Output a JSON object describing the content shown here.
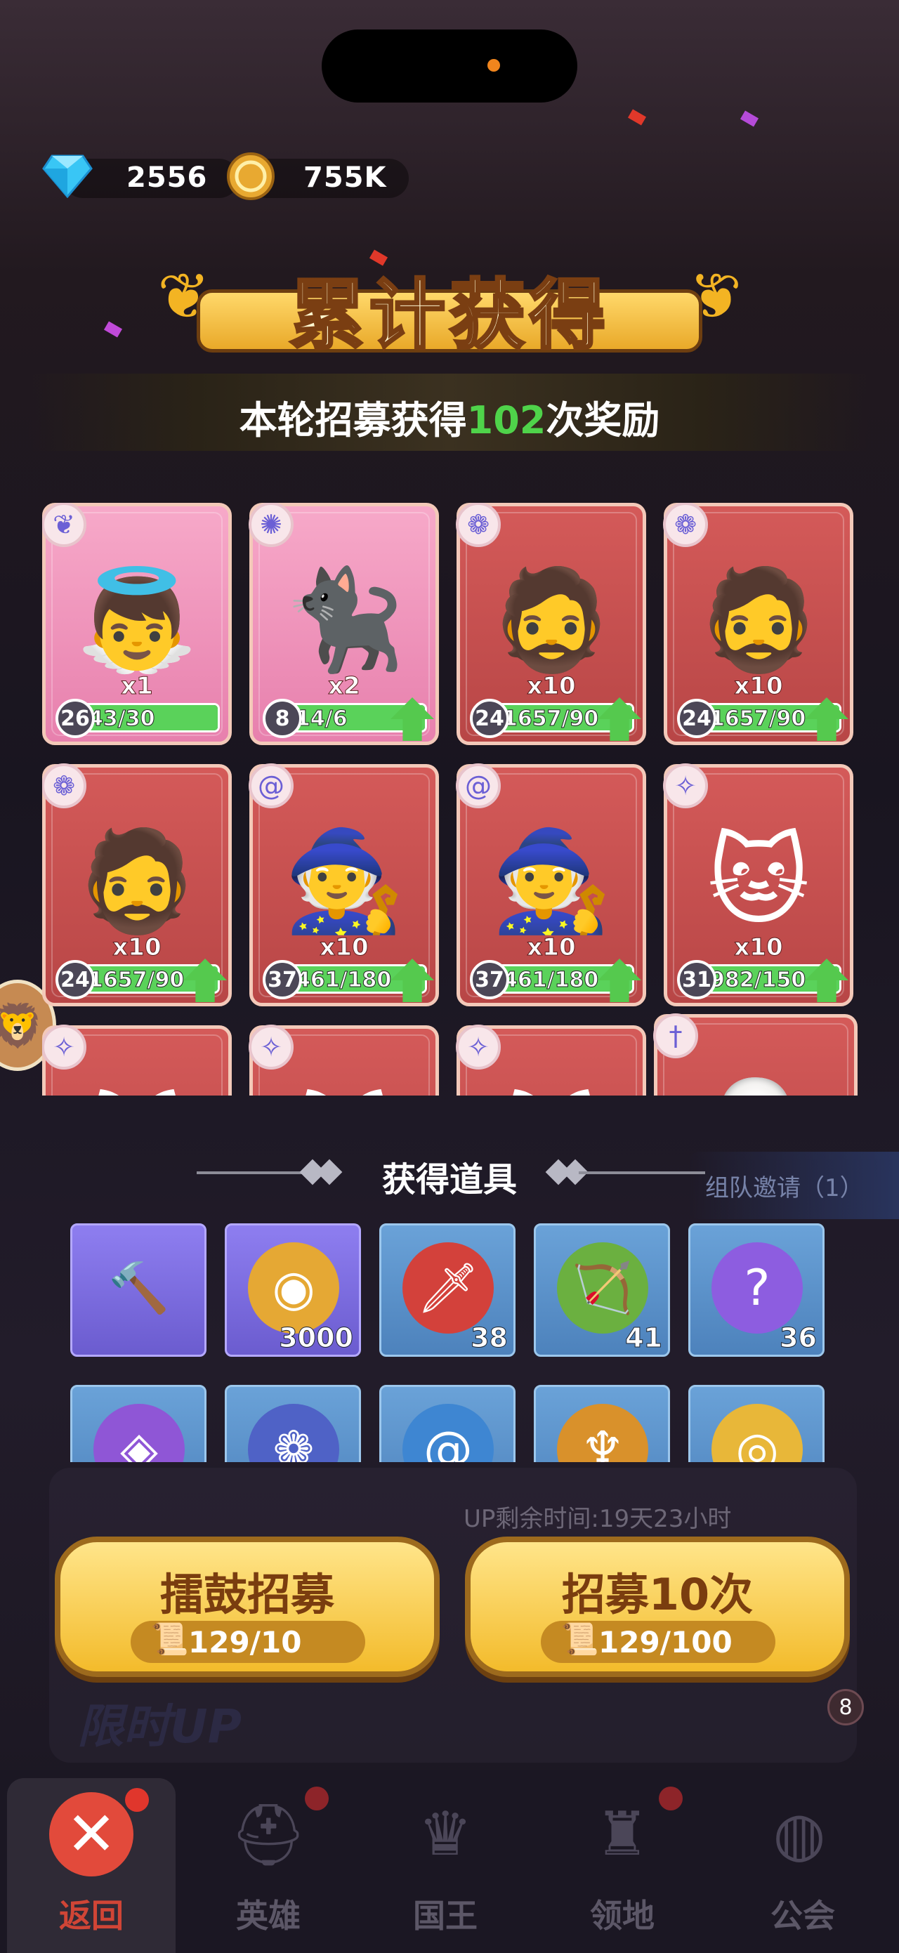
{
  "currency": {
    "gems": {
      "icon": "diamond-icon",
      "value": "2556"
    },
    "gold": {
      "icon": "gold-coin-icon",
      "value": "755K"
    }
  },
  "banner": {
    "title": "累计获得",
    "subtitle_prefix": "本轮招募获得",
    "subtitle_count": "102",
    "subtitle_suffix": "次奖励"
  },
  "heroes": [
    {
      "rarity": "pink",
      "badge": "laurel-emblem-icon",
      "figure": "angel-hero",
      "qty": "x1",
      "level": "26",
      "progress_text": "43/30",
      "progress": 1.0,
      "upgradable": false
    },
    {
      "rarity": "pink",
      "badge": "star-eye-emblem-icon",
      "figure": "shadow-cat-hero",
      "qty": "x2",
      "level": "8",
      "progress_text": "14/6",
      "progress": 1.0,
      "upgradable": true
    },
    {
      "rarity": "red",
      "badge": "paw-emblem-icon",
      "figure": "trident-warrior-hero",
      "qty": "x10",
      "level": "24",
      "progress_text": "1657/90",
      "progress": 1.0,
      "upgradable": true
    },
    {
      "rarity": "red",
      "badge": "paw-emblem-icon",
      "figure": "trident-warrior-hero",
      "qty": "x10",
      "level": "24",
      "progress_text": "1657/90",
      "progress": 1.0,
      "upgradable": true
    },
    {
      "rarity": "red",
      "badge": "paw-emblem-icon",
      "figure": "trident-warrior-hero",
      "qty": "x10",
      "level": "24",
      "progress_text": "1657/90",
      "progress": 1.0,
      "upgradable": true
    },
    {
      "rarity": "red",
      "badge": "swirl-emblem-icon",
      "figure": "mage-girl-hero",
      "qty": "x10",
      "level": "37",
      "progress_text": "461/180",
      "progress": 1.0,
      "upgradable": true
    },
    {
      "rarity": "red",
      "badge": "swirl-emblem-icon",
      "figure": "mage-girl-hero",
      "qty": "x10",
      "level": "37",
      "progress_text": "461/180",
      "progress": 1.0,
      "upgradable": true
    },
    {
      "rarity": "red",
      "badge": "bow-emblem-icon",
      "figure": "diver-cat-hero",
      "qty": "x10",
      "level": "31",
      "progress_text": "982/150",
      "progress": 1.0,
      "upgradable": true
    },
    {
      "rarity": "red",
      "badge": "bow-emblem-icon",
      "figure": "cat-hero-partial",
      "qty": "",
      "level": "",
      "progress_text": "",
      "progress": 0,
      "upgradable": false
    },
    {
      "rarity": "red",
      "badge": "bow-emblem-icon",
      "figure": "cat-hero-partial",
      "qty": "",
      "level": "",
      "progress_text": "",
      "progress": 0,
      "upgradable": false
    },
    {
      "rarity": "red",
      "badge": "bow-emblem-icon",
      "figure": "cat-hero-partial",
      "qty": "",
      "level": "",
      "progress_text": "",
      "progress": 0,
      "upgradable": false
    },
    {
      "rarity": "red",
      "badge": "sword-emblem-icon",
      "figure": "white-hair-hero-partial",
      "qty": "",
      "level": "",
      "progress_text": "",
      "progress": 0,
      "upgradable": false
    }
  ],
  "items_section": {
    "title": "获得道具",
    "invite_text": "组队邀请（1）"
  },
  "items": [
    {
      "icon": "hammer-icon",
      "color": "purple",
      "count": ""
    },
    {
      "icon": "gold-token-icon",
      "color": "purple",
      "count": "3000"
    },
    {
      "icon": "sword-orb-icon",
      "color": "blue",
      "count": "38"
    },
    {
      "icon": "bow-orb-icon",
      "color": "blue",
      "count": "41"
    },
    {
      "icon": "swirl-orb-icon",
      "color": "blue",
      "count": "36"
    },
    {
      "icon": "diamond-orb-icon",
      "color": "blue",
      "count": ""
    },
    {
      "icon": "paw-orb-icon",
      "color": "blue",
      "count": ""
    },
    {
      "icon": "spiral-orb-icon",
      "color": "blue",
      "count": ""
    },
    {
      "icon": "crest-orb-icon",
      "color": "blue",
      "count": ""
    },
    {
      "icon": "coin-orb-icon",
      "color": "blue",
      "count": ""
    }
  ],
  "behind": {
    "uptime": "UP剩余时间:19天23小时",
    "limit_text": "限时UP",
    "notif_count": "8"
  },
  "buttons": {
    "drum_recruit": {
      "label": "擂鼓招募",
      "cost": "129/10"
    },
    "recruit_ten": {
      "label": "招募10次",
      "cost": "129/100"
    }
  },
  "nav": [
    {
      "label": "返回",
      "icon": "close-icon"
    },
    {
      "label": "英雄",
      "icon": "helmet-icon"
    },
    {
      "label": "国王",
      "icon": "crown-icon"
    },
    {
      "label": "领地",
      "icon": "castle-icon"
    },
    {
      "label": "公会",
      "icon": "globe-icon"
    }
  ]
}
